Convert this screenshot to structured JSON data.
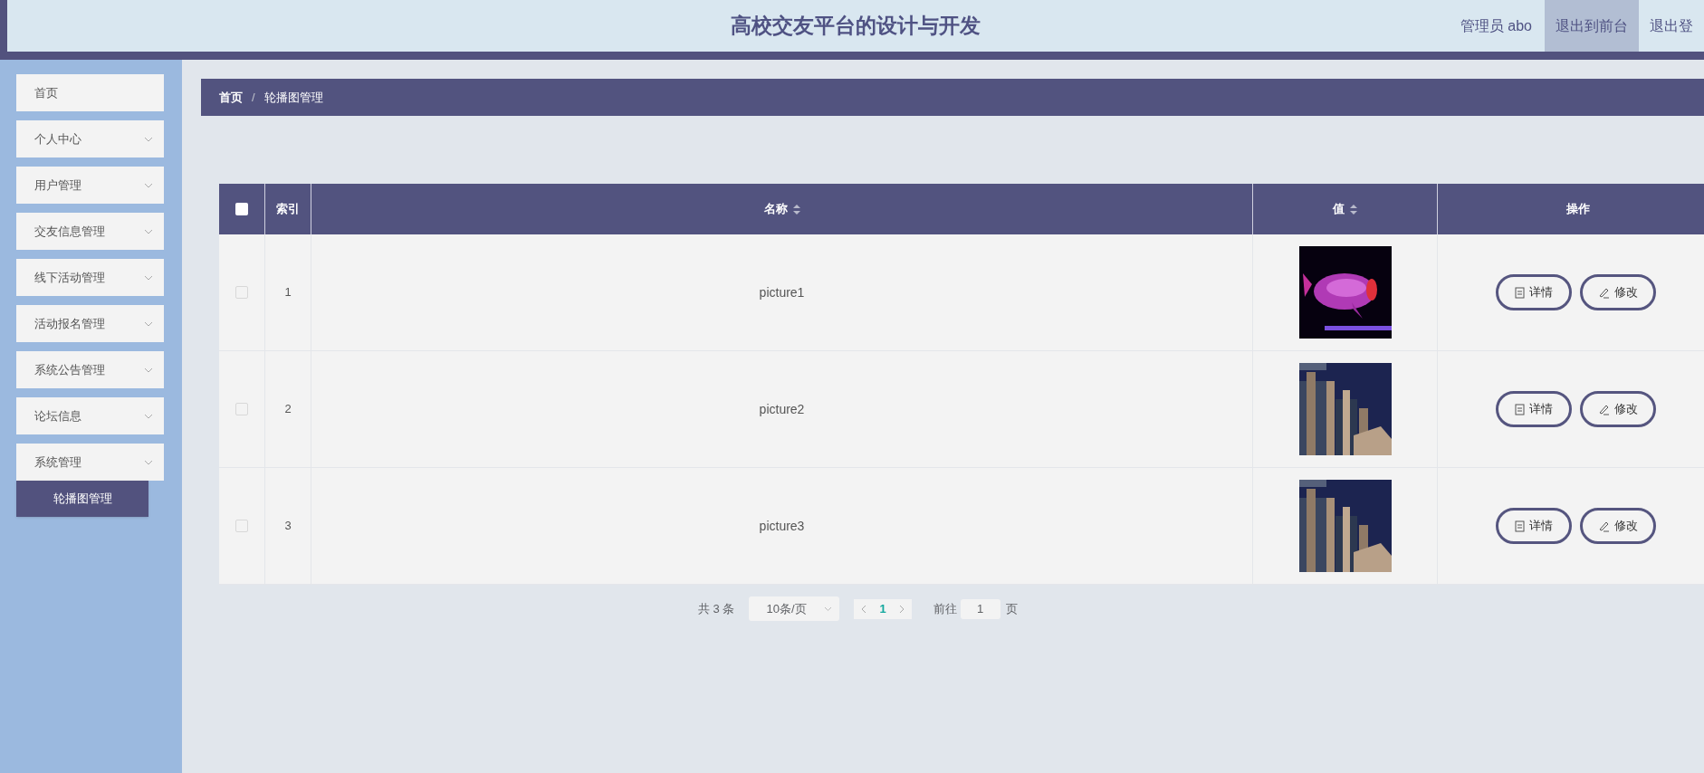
{
  "header": {
    "title": "高校交友平台的设计与开发",
    "user": "管理员 abo",
    "links": [
      {
        "label": "退出到前台",
        "selected": true
      },
      {
        "label": "退出登",
        "selected": false
      }
    ]
  },
  "sidebar": {
    "items": [
      {
        "label": "首页",
        "expandable": false
      },
      {
        "label": "个人中心",
        "expandable": true
      },
      {
        "label": "用户管理",
        "expandable": true
      },
      {
        "label": "交友信息管理",
        "expandable": true
      },
      {
        "label": "线下活动管理",
        "expandable": true
      },
      {
        "label": "活动报名管理",
        "expandable": true
      },
      {
        "label": "系统公告管理",
        "expandable": true
      },
      {
        "label": "论坛信息",
        "expandable": true
      },
      {
        "label": "系统管理",
        "expandable": true,
        "children": [
          {
            "label": "轮播图管理",
            "selected": true
          }
        ]
      }
    ]
  },
  "breadcrumb": {
    "items": [
      "首页",
      "轮播图管理"
    ],
    "separator": "/"
  },
  "table": {
    "select_all_checked": false,
    "columns": [
      {
        "label": "索引",
        "sortable": false
      },
      {
        "label": "名称",
        "sortable": true
      },
      {
        "label": "值",
        "sortable": true
      },
      {
        "label": "操作",
        "sortable": false
      }
    ],
    "rows": [
      {
        "checked": false,
        "index": "1",
        "name": "picture1",
        "value": {
          "kind": "picture"
        },
        "actions": [
          "详情",
          "修改"
        ]
      },
      {
        "checked": false,
        "index": "2",
        "name": "picture2",
        "value": {
          "kind": "picture"
        },
        "actions": [
          "详情",
          "修改"
        ]
      },
      {
        "checked": false,
        "index": "3",
        "name": "picture3",
        "value": {
          "kind": "picture"
        },
        "actions": [
          "详情",
          "修改"
        ]
      }
    ]
  },
  "pagination": {
    "total": "共 3 条",
    "page_size": "10条/页",
    "pages": [
      {
        "label": "1",
        "selected": true
      }
    ],
    "goto_label": "前往",
    "goto_value": "1",
    "goto_suffix": "页"
  }
}
